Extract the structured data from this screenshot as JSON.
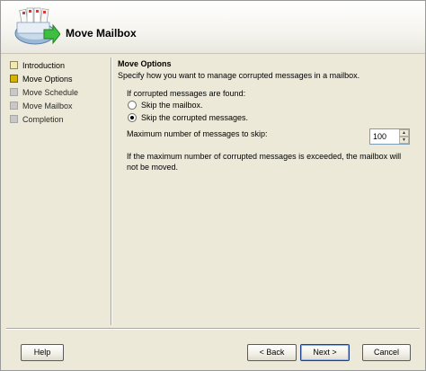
{
  "header": {
    "title": "Move Mailbox"
  },
  "nav": {
    "items": [
      {
        "label": "Introduction",
        "state": "done"
      },
      {
        "label": "Move Options",
        "state": "current"
      },
      {
        "label": "Move Schedule",
        "state": "pending"
      },
      {
        "label": "Move Mailbox",
        "state": "pending"
      },
      {
        "label": "Completion",
        "state": "pending"
      }
    ]
  },
  "content": {
    "section_title": "Move Options",
    "section_desc": "Specify how you want to manage corrupted messages in a mailbox.",
    "group_label": "If corrupted messages are found:",
    "options": [
      {
        "label": "Skip the mailbox.",
        "checked": false
      },
      {
        "label": "Skip the corrupted messages.",
        "checked": true
      }
    ],
    "max_label": "Maximum number of messages to skip:",
    "max_value": "100",
    "note": "If the maximum number of corrupted messages is exceeded, the mailbox will not be moved."
  },
  "footer": {
    "help_label": "Help",
    "back_label": "< Back",
    "next_label": "Next >",
    "cancel_label": "Cancel"
  },
  "colors": {
    "background": "#ece9d8",
    "current_step": "#d8b400",
    "default_button_border": "#1f3f8a"
  }
}
